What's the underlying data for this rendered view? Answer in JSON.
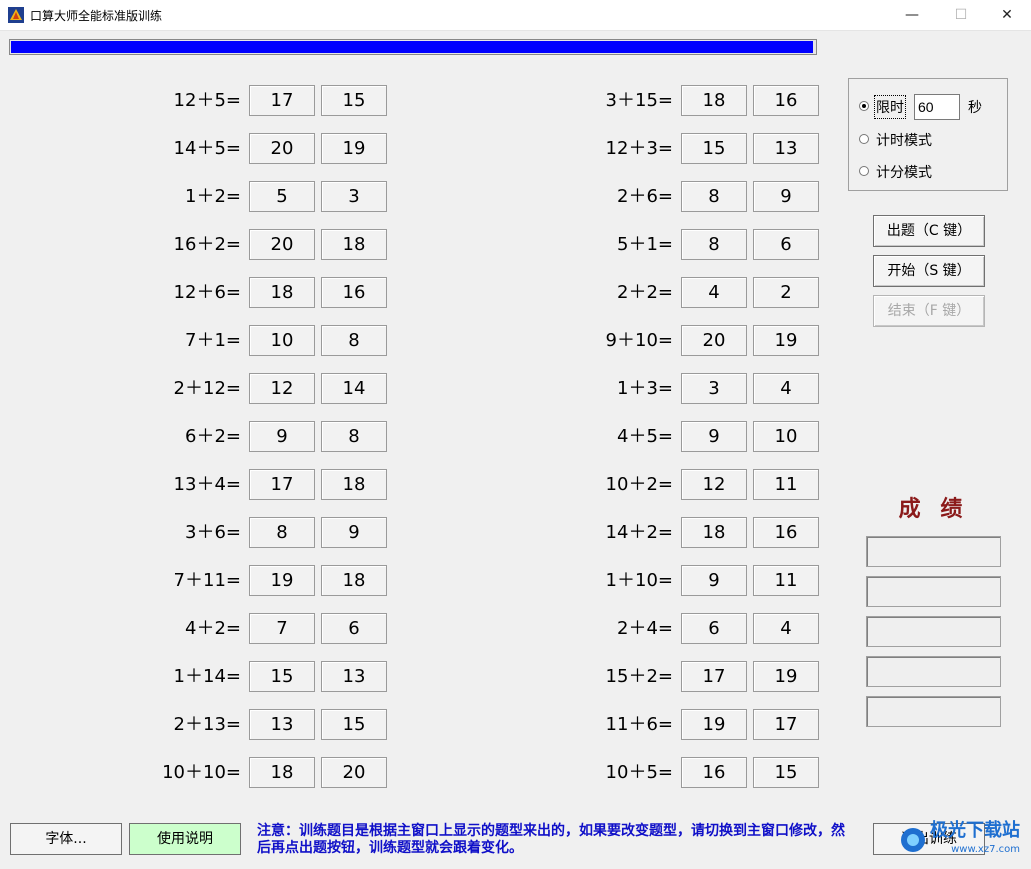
{
  "window": {
    "title": "口算大师全能标准版训练",
    "minimize": "—",
    "maximize": "☐",
    "close": "✕"
  },
  "progress": {
    "fill_fraction": 0.997,
    "color": "#0000ff"
  },
  "questions": [
    {
      "expr": "12＋5=",
      "a": "17",
      "b": "15"
    },
    {
      "expr": "14＋5=",
      "a": "20",
      "b": "19"
    },
    {
      "expr": "1＋2=",
      "a": "5",
      "b": "3"
    },
    {
      "expr": "16＋2=",
      "a": "20",
      "b": "18"
    },
    {
      "expr": "12＋6=",
      "a": "18",
      "b": "16"
    },
    {
      "expr": "7＋1=",
      "a": "10",
      "b": "8"
    },
    {
      "expr": "2＋12=",
      "a": "12",
      "b": "14"
    },
    {
      "expr": "6＋2=",
      "a": "9",
      "b": "8"
    },
    {
      "expr": "13＋4=",
      "a": "17",
      "b": "18"
    },
    {
      "expr": "3＋6=",
      "a": "8",
      "b": "9"
    },
    {
      "expr": "7＋11=",
      "a": "19",
      "b": "18"
    },
    {
      "expr": "4＋2=",
      "a": "7",
      "b": "6"
    },
    {
      "expr": "1＋14=",
      "a": "15",
      "b": "13"
    },
    {
      "expr": "2＋13=",
      "a": "13",
      "b": "15"
    },
    {
      "expr": "10＋10=",
      "a": "18",
      "b": "20"
    },
    {
      "expr": "3＋15=",
      "a": "18",
      "b": "16"
    },
    {
      "expr": "12＋3=",
      "a": "15",
      "b": "13"
    },
    {
      "expr": "2＋6=",
      "a": "8",
      "b": "9"
    },
    {
      "expr": "5＋1=",
      "a": "8",
      "b": "6"
    },
    {
      "expr": "2＋2=",
      "a": "4",
      "b": "2"
    },
    {
      "expr": "9＋10=",
      "a": "20",
      "b": "19"
    },
    {
      "expr": "1＋3=",
      "a": "3",
      "b": "4"
    },
    {
      "expr": "4＋5=",
      "a": "9",
      "b": "10"
    },
    {
      "expr": "10＋2=",
      "a": "12",
      "b": "11"
    },
    {
      "expr": "14＋2=",
      "a": "18",
      "b": "16"
    },
    {
      "expr": "1＋10=",
      "a": "9",
      "b": "11"
    },
    {
      "expr": "2＋4=",
      "a": "6",
      "b": "4"
    },
    {
      "expr": "15＋2=",
      "a": "17",
      "b": "19"
    },
    {
      "expr": "11＋6=",
      "a": "19",
      "b": "17"
    },
    {
      "expr": "10＋5=",
      "a": "16",
      "b": "15"
    }
  ],
  "modes": {
    "time_limit_label": "限时",
    "time_limit_value": "60",
    "seconds_label": "秒",
    "timer_mode_label": "计时模式",
    "score_mode_label": "计分模式",
    "selected": "time_limit"
  },
  "buttons": {
    "generate": "出题（C 键）",
    "start": "开始（S 键）",
    "finish": "结束（F 键）",
    "font": "字体...",
    "help": "使用说明",
    "exit": "退出训练"
  },
  "score": {
    "title": "成 绩",
    "rows": [
      "",
      "",
      "",
      "",
      ""
    ]
  },
  "notice": "注意：训练题目是根据主窗口上显示的题型来出的，如果要改变题型，请切换到主窗口修改，然后再点出题按钮，训练题型就会跟着变化。",
  "watermark": {
    "text": "极光下载站",
    "sub": "www.xz7.com"
  },
  "colors": {
    "help_button_bg": "#ccffcc",
    "notice_text": "#1010c8",
    "score_title": "#8b1a1a"
  }
}
